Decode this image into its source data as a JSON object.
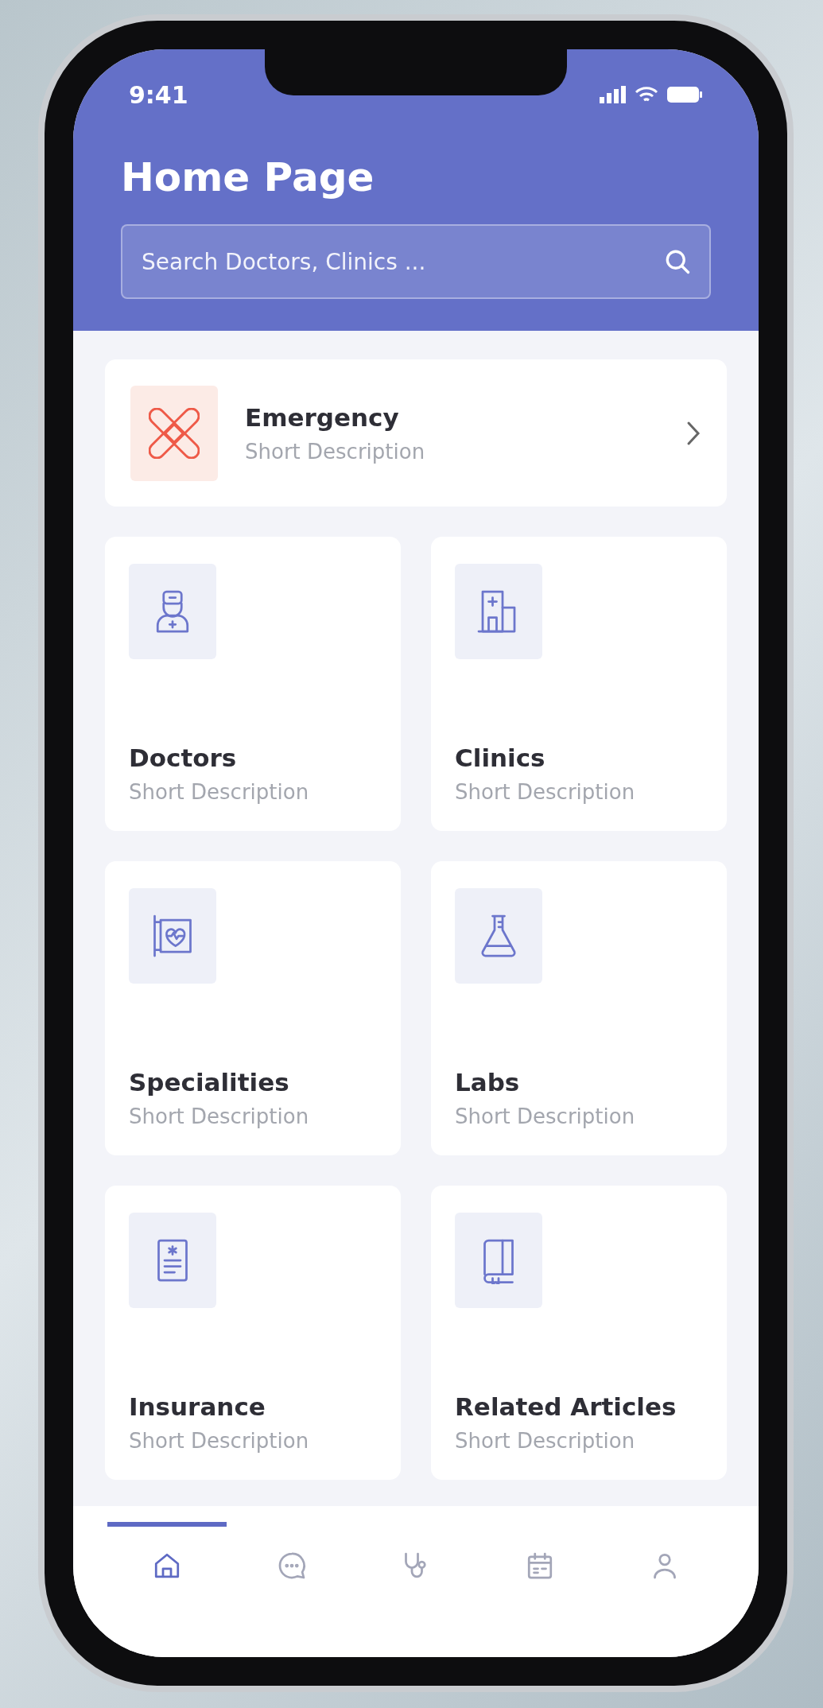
{
  "status_bar": {
    "time": "9:41"
  },
  "header": {
    "title": "Home Page",
    "search": {
      "placeholder": "Search Doctors, Clinics ..."
    }
  },
  "emergency": {
    "kind": "bandage",
    "title": "Emergency",
    "description": "Short Description"
  },
  "categories": [
    {
      "kind": "doctor",
      "title": "Doctors",
      "description": "Short Description"
    },
    {
      "kind": "clinic",
      "title": "Clinics",
      "description": "Short Description"
    },
    {
      "kind": "heart",
      "title": "Specialities",
      "description": "Short Description"
    },
    {
      "kind": "flask",
      "title": "Labs",
      "description": "Short Description"
    },
    {
      "kind": "document",
      "title": "Insurance",
      "description": "Short Description"
    },
    {
      "kind": "book",
      "title": "Related Articles",
      "description": "Short Description"
    }
  ],
  "tab_bar": [
    {
      "kind": "home",
      "selected": true
    },
    {
      "kind": "chat",
      "selected": false
    },
    {
      "kind": "stethoscope",
      "selected": false
    },
    {
      "kind": "calendar",
      "selected": false
    },
    {
      "kind": "profile",
      "selected": false
    }
  ]
}
